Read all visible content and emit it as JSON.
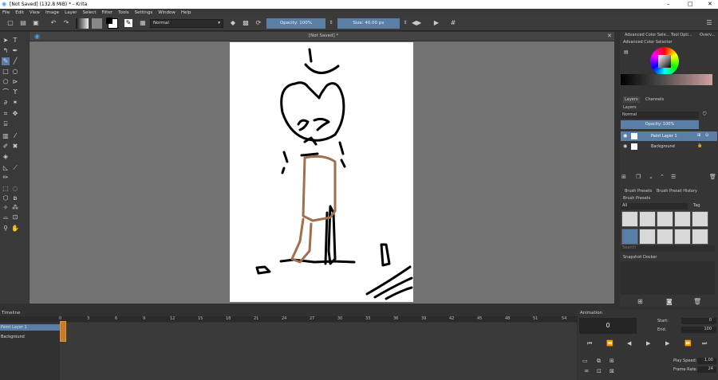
{
  "window": {
    "title": "[Not Saved]  (132.8 MiB)  * - Krita",
    "minimize": "–",
    "maximize": "□",
    "close": "✕"
  },
  "menu": [
    "File",
    "Edit",
    "View",
    "Image",
    "Layer",
    "Select",
    "Filter",
    "Tools",
    "Settings",
    "Window",
    "Help"
  ],
  "toolbar": {
    "blend_mode": "Normal",
    "opacity": "Opacity: 100%",
    "size": "Size: 40.00 px"
  },
  "document": {
    "tab_title": "[Not Saved]  *",
    "close": "✕"
  },
  "dockers": {
    "tabs": [
      "Advanced Color Sele...",
      "Tool Opti...",
      "Overv..."
    ],
    "color_selector_title": "Advanced Color Selector",
    "layers_tabs": [
      "Layers",
      "Channels"
    ],
    "layers_title": "Layers",
    "layer_blend": "Normal",
    "layer_opacity": "Opacity:  100%",
    "layers": [
      {
        "name": "Paint Layer 1",
        "selected": true
      },
      {
        "name": "Background",
        "selected": false
      }
    ],
    "brush_tabs": [
      "Brush Presets",
      "Brush Preset History"
    ],
    "brush_title": "Brush Presets",
    "brush_filter": "All",
    "brush_tag": "Tag",
    "search_placeholder": "Search",
    "snapshot_title": "Snapshot Docker"
  },
  "timeline": {
    "title": "Timeline",
    "frame_numbers": [
      "0",
      "3",
      "6",
      "9",
      "12",
      "15",
      "18",
      "21",
      "24",
      "27",
      "30",
      "33",
      "36",
      "39",
      "42",
      "45",
      "48",
      "51",
      "54"
    ],
    "layers": [
      "Paint Layer 1",
      "Background"
    ]
  },
  "animation": {
    "title": "Animation",
    "current_frame": "0",
    "start_label": "Start:",
    "start": "0",
    "end_label": "End:",
    "end": "100",
    "play_speed_label": "Play Speed:",
    "play_speed": "1.00",
    "frame_rate_label": "Frame Rate:",
    "frame_rate": "24"
  },
  "colors": {
    "accent": "#5a7ea6",
    "selected_frame": "#e8952b"
  }
}
